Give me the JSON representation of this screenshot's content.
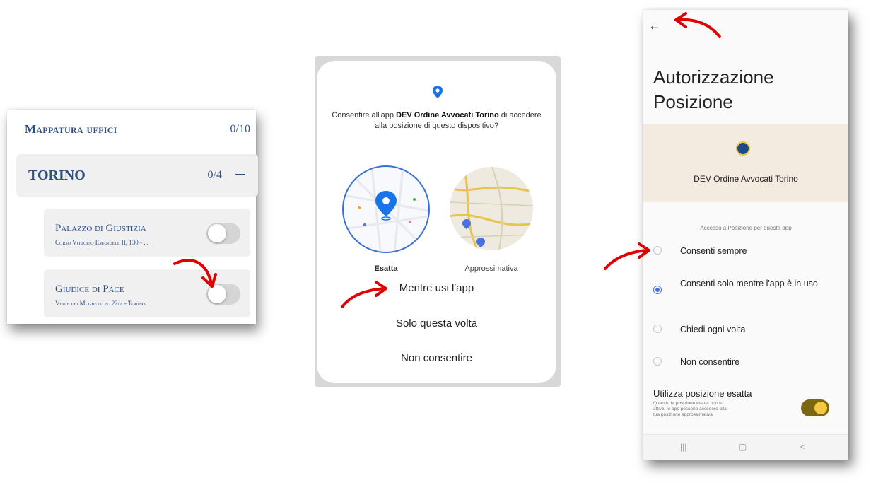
{
  "panel_office": {
    "title": "Mappatura uffici",
    "count": "0/10",
    "city": {
      "name": "TORINO",
      "count": "0/4"
    },
    "offices": [
      {
        "name": "Palazzo di Giustizia",
        "address": "Corso Vittorio Emanuele II, 130 - ...",
        "enabled": false
      },
      {
        "name": "Giudice di Pace",
        "address": "Viale dei Mughetti n. 22/a - Torino",
        "enabled": false
      }
    ]
  },
  "panel_dialog": {
    "message_pre": "Consentire all'app ",
    "app_name": "DEV Ordine Avvocati Torino",
    "message_post": " di accedere alla posizione di questo dispositivo?",
    "precision_exact": "Esatta",
    "precision_approx": "Approssimativa",
    "options": [
      "Mentre usi l'app",
      "Solo questa volta",
      "Non consentire"
    ]
  },
  "panel_settings": {
    "back_icon": "←",
    "title": "Autorizzazione Posizione",
    "app_name": "DEV Ordine Avvocati Torino",
    "section_label": "Accesso a Posizione per questa app",
    "options": [
      {
        "label": "Consenti sempre",
        "selected": false
      },
      {
        "label": "Consenti solo mentre l'app è in uso",
        "selected": true
      },
      {
        "label": "Chiedi ogni volta",
        "selected": false
      },
      {
        "label": "Non consentire",
        "selected": false
      }
    ],
    "exact": {
      "title": "Utilizza posizione esatta",
      "description": "Quando la posizione esatta non è attiva, le app possono accedere alla tua posizione approssimativa",
      "enabled": true
    },
    "nav": {
      "recents": "|||",
      "home": "▢",
      "back": "<"
    }
  },
  "colors": {
    "brand_blue": "#2c4f86",
    "accent_blue": "#3b6fd4",
    "toggle_on": "#7a6613",
    "arrow_red": "#e00000"
  }
}
